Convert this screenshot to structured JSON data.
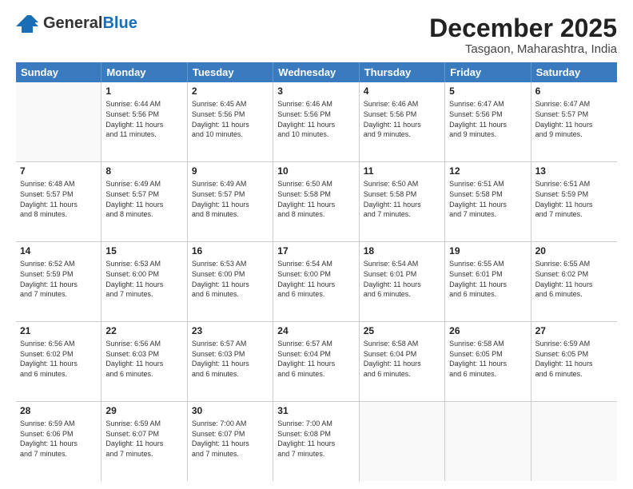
{
  "header": {
    "logo_general": "General",
    "logo_blue": "Blue",
    "month_title": "December 2025",
    "location": "Tasgaon, Maharashtra, India"
  },
  "calendar": {
    "days_of_week": [
      "Sunday",
      "Monday",
      "Tuesday",
      "Wednesday",
      "Thursday",
      "Friday",
      "Saturday"
    ],
    "weeks": [
      [
        {
          "day": "",
          "info": ""
        },
        {
          "day": "1",
          "info": "Sunrise: 6:44 AM\nSunset: 5:56 PM\nDaylight: 11 hours\nand 11 minutes."
        },
        {
          "day": "2",
          "info": "Sunrise: 6:45 AM\nSunset: 5:56 PM\nDaylight: 11 hours\nand 10 minutes."
        },
        {
          "day": "3",
          "info": "Sunrise: 6:46 AM\nSunset: 5:56 PM\nDaylight: 11 hours\nand 10 minutes."
        },
        {
          "day": "4",
          "info": "Sunrise: 6:46 AM\nSunset: 5:56 PM\nDaylight: 11 hours\nand 9 minutes."
        },
        {
          "day": "5",
          "info": "Sunrise: 6:47 AM\nSunset: 5:56 PM\nDaylight: 11 hours\nand 9 minutes."
        },
        {
          "day": "6",
          "info": "Sunrise: 6:47 AM\nSunset: 5:57 PM\nDaylight: 11 hours\nand 9 minutes."
        }
      ],
      [
        {
          "day": "7",
          "info": "Sunrise: 6:48 AM\nSunset: 5:57 PM\nDaylight: 11 hours\nand 8 minutes."
        },
        {
          "day": "8",
          "info": "Sunrise: 6:49 AM\nSunset: 5:57 PM\nDaylight: 11 hours\nand 8 minutes."
        },
        {
          "day": "9",
          "info": "Sunrise: 6:49 AM\nSunset: 5:57 PM\nDaylight: 11 hours\nand 8 minutes."
        },
        {
          "day": "10",
          "info": "Sunrise: 6:50 AM\nSunset: 5:58 PM\nDaylight: 11 hours\nand 8 minutes."
        },
        {
          "day": "11",
          "info": "Sunrise: 6:50 AM\nSunset: 5:58 PM\nDaylight: 11 hours\nand 7 minutes."
        },
        {
          "day": "12",
          "info": "Sunrise: 6:51 AM\nSunset: 5:58 PM\nDaylight: 11 hours\nand 7 minutes."
        },
        {
          "day": "13",
          "info": "Sunrise: 6:51 AM\nSunset: 5:59 PM\nDaylight: 11 hours\nand 7 minutes."
        }
      ],
      [
        {
          "day": "14",
          "info": "Sunrise: 6:52 AM\nSunset: 5:59 PM\nDaylight: 11 hours\nand 7 minutes."
        },
        {
          "day": "15",
          "info": "Sunrise: 6:53 AM\nSunset: 6:00 PM\nDaylight: 11 hours\nand 7 minutes."
        },
        {
          "day": "16",
          "info": "Sunrise: 6:53 AM\nSunset: 6:00 PM\nDaylight: 11 hours\nand 6 minutes."
        },
        {
          "day": "17",
          "info": "Sunrise: 6:54 AM\nSunset: 6:00 PM\nDaylight: 11 hours\nand 6 minutes."
        },
        {
          "day": "18",
          "info": "Sunrise: 6:54 AM\nSunset: 6:01 PM\nDaylight: 11 hours\nand 6 minutes."
        },
        {
          "day": "19",
          "info": "Sunrise: 6:55 AM\nSunset: 6:01 PM\nDaylight: 11 hours\nand 6 minutes."
        },
        {
          "day": "20",
          "info": "Sunrise: 6:55 AM\nSunset: 6:02 PM\nDaylight: 11 hours\nand 6 minutes."
        }
      ],
      [
        {
          "day": "21",
          "info": "Sunrise: 6:56 AM\nSunset: 6:02 PM\nDaylight: 11 hours\nand 6 minutes."
        },
        {
          "day": "22",
          "info": "Sunrise: 6:56 AM\nSunset: 6:03 PM\nDaylight: 11 hours\nand 6 minutes."
        },
        {
          "day": "23",
          "info": "Sunrise: 6:57 AM\nSunset: 6:03 PM\nDaylight: 11 hours\nand 6 minutes."
        },
        {
          "day": "24",
          "info": "Sunrise: 6:57 AM\nSunset: 6:04 PM\nDaylight: 11 hours\nand 6 minutes."
        },
        {
          "day": "25",
          "info": "Sunrise: 6:58 AM\nSunset: 6:04 PM\nDaylight: 11 hours\nand 6 minutes."
        },
        {
          "day": "26",
          "info": "Sunrise: 6:58 AM\nSunset: 6:05 PM\nDaylight: 11 hours\nand 6 minutes."
        },
        {
          "day": "27",
          "info": "Sunrise: 6:59 AM\nSunset: 6:05 PM\nDaylight: 11 hours\nand 6 minutes."
        }
      ],
      [
        {
          "day": "28",
          "info": "Sunrise: 6:59 AM\nSunset: 6:06 PM\nDaylight: 11 hours\nand 7 minutes."
        },
        {
          "day": "29",
          "info": "Sunrise: 6:59 AM\nSunset: 6:07 PM\nDaylight: 11 hours\nand 7 minutes."
        },
        {
          "day": "30",
          "info": "Sunrise: 7:00 AM\nSunset: 6:07 PM\nDaylight: 11 hours\nand 7 minutes."
        },
        {
          "day": "31",
          "info": "Sunrise: 7:00 AM\nSunset: 6:08 PM\nDaylight: 11 hours\nand 7 minutes."
        },
        {
          "day": "",
          "info": ""
        },
        {
          "day": "",
          "info": ""
        },
        {
          "day": "",
          "info": ""
        }
      ]
    ]
  }
}
